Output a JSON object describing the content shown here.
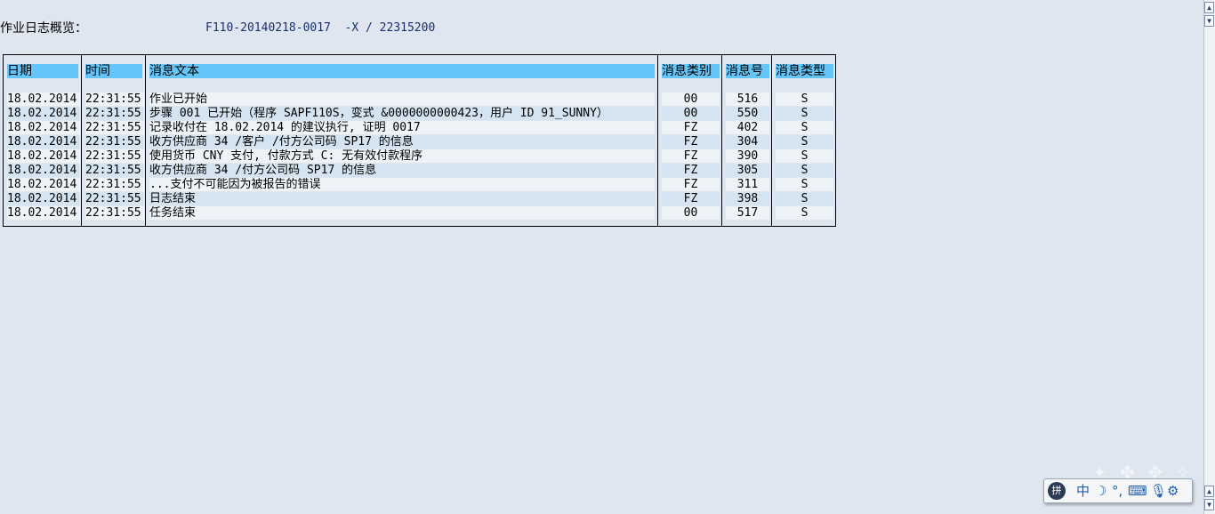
{
  "header": {
    "label": "作业日志概览：",
    "value": "F110-20140218-0017  -X / 22315200"
  },
  "columns": {
    "date": "日期",
    "time": "时间",
    "text": "消息文本",
    "msg_class": "消息类别",
    "msg_no": "消息号",
    "msg_type": "消息类型"
  },
  "rows": [
    {
      "date": "18.02.2014",
      "time": "22:31:55",
      "text": "作业已开始",
      "msg_class": "00",
      "msg_no": "516",
      "msg_type": "S"
    },
    {
      "date": "18.02.2014",
      "time": "22:31:55",
      "text": "步骤 001 已开始（程序 SAPF110S，变式 &0000000000423，用户 ID 91_SUNNY）",
      "msg_class": "00",
      "msg_no": "550",
      "msg_type": "S"
    },
    {
      "date": "18.02.2014",
      "time": "22:31:55",
      "text": "记录收付在 18.02.2014 的建议执行, 证明 0017",
      "msg_class": "FZ",
      "msg_no": "402",
      "msg_type": "S"
    },
    {
      "date": "18.02.2014",
      "time": "22:31:55",
      "text": "收方供应商 34 /客户  /付方公司码 SP17 的信息",
      "msg_class": "FZ",
      "msg_no": "304",
      "msg_type": "S"
    },
    {
      "date": "18.02.2014",
      "time": "22:31:55",
      "text": "使用货币 CNY 支付, 付款方式 C: 无有效付款程序",
      "msg_class": "FZ",
      "msg_no": "390",
      "msg_type": "S"
    },
    {
      "date": "18.02.2014",
      "time": "22:31:55",
      "text": "收方供应商 34 /付方公司码 SP17 的信息",
      "msg_class": "FZ",
      "msg_no": "305",
      "msg_type": "S"
    },
    {
      "date": "18.02.2014",
      "time": "22:31:55",
      "text": "...支付不可能因为被报告的错误",
      "msg_class": "FZ",
      "msg_no": "311",
      "msg_type": "S"
    },
    {
      "date": "18.02.2014",
      "time": "22:31:55",
      "text": "日志结束",
      "msg_class": "FZ",
      "msg_no": "398",
      "msg_type": "S"
    },
    {
      "date": "18.02.2014",
      "time": "22:31:55",
      "text": "任务结束",
      "msg_class": "00",
      "msg_no": "517",
      "msg_type": "S"
    }
  ],
  "scrollbar": {
    "up_icon": "arrow-up-icon",
    "down_icon": "arrow-down-icon"
  },
  "ime_toolbar": {
    "logo": "拼",
    "mode": "中",
    "icons": [
      "moon-icon",
      "punctuation-icon",
      "keyboard-icon",
      "microphone-icon",
      "gear-icon"
    ]
  }
}
